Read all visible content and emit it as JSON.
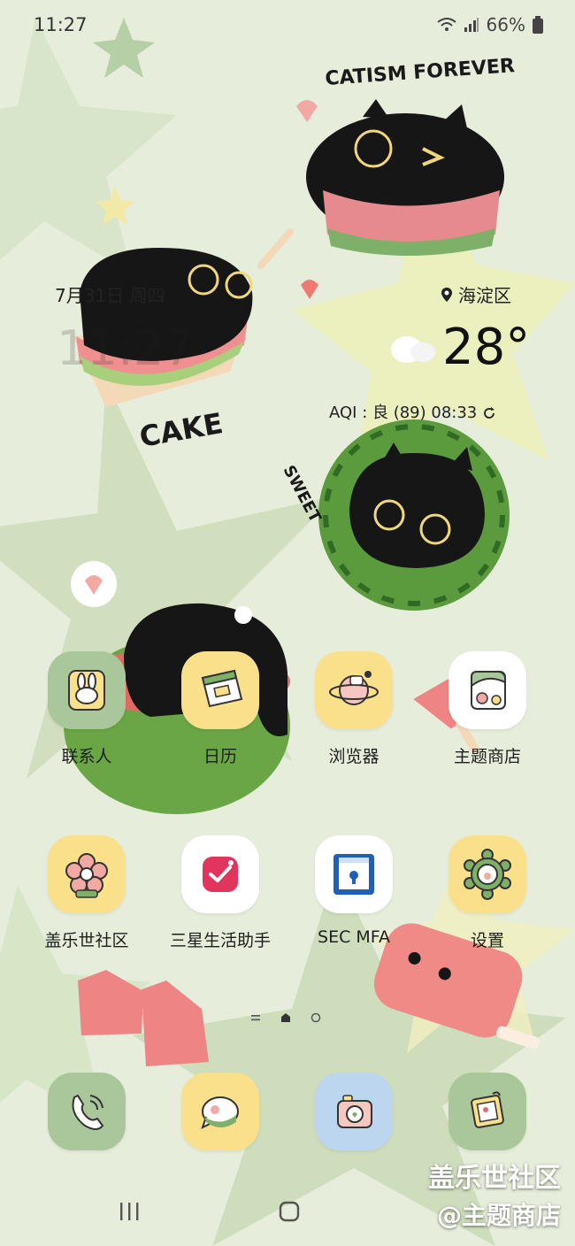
{
  "status_bar": {
    "time": "11:27",
    "battery": "66%"
  },
  "widget": {
    "date": "7月31日 周四",
    "location": "海淀区",
    "clock": "11:27",
    "temperature": "28°",
    "aqi": "AQI : 良 (89)   08:33"
  },
  "wallpaper_text": {
    "top": "CATISM FOREVER",
    "cake": "CAKE",
    "sweet": "SWEET"
  },
  "apps_row1": [
    {
      "label": "联系人",
      "icon": "bunny-contacts-icon"
    },
    {
      "label": "日历",
      "icon": "calendar-icon"
    },
    {
      "label": "浏览器",
      "icon": "planet-browser-icon"
    },
    {
      "label": "主题商店",
      "icon": "theme-store-icon"
    }
  ],
  "apps_row2": [
    {
      "label": "盖乐世社区",
      "icon": "flower-community-icon"
    },
    {
      "label": "三星生活助手",
      "icon": "life-assistant-icon"
    },
    {
      "label": "SEC MFA",
      "icon": "sec-mfa-icon"
    },
    {
      "label": "设置",
      "icon": "gear-icon"
    }
  ],
  "dock": [
    {
      "icon": "phone-icon"
    },
    {
      "icon": "messages-icon"
    },
    {
      "icon": "camera-icon"
    },
    {
      "icon": "gallery-icon"
    }
  ],
  "watermark": {
    "line1": "盖乐世社区",
    "line2": "@主题商店"
  },
  "colors": {
    "wall_base": "#dfe8d2",
    "tile_green": "#a9c79a",
    "tile_yellow": "#fbe08c",
    "tile_blue": "#bcd6ef",
    "tile_white": "#ffffff",
    "accent_pink": "#e0355d"
  }
}
